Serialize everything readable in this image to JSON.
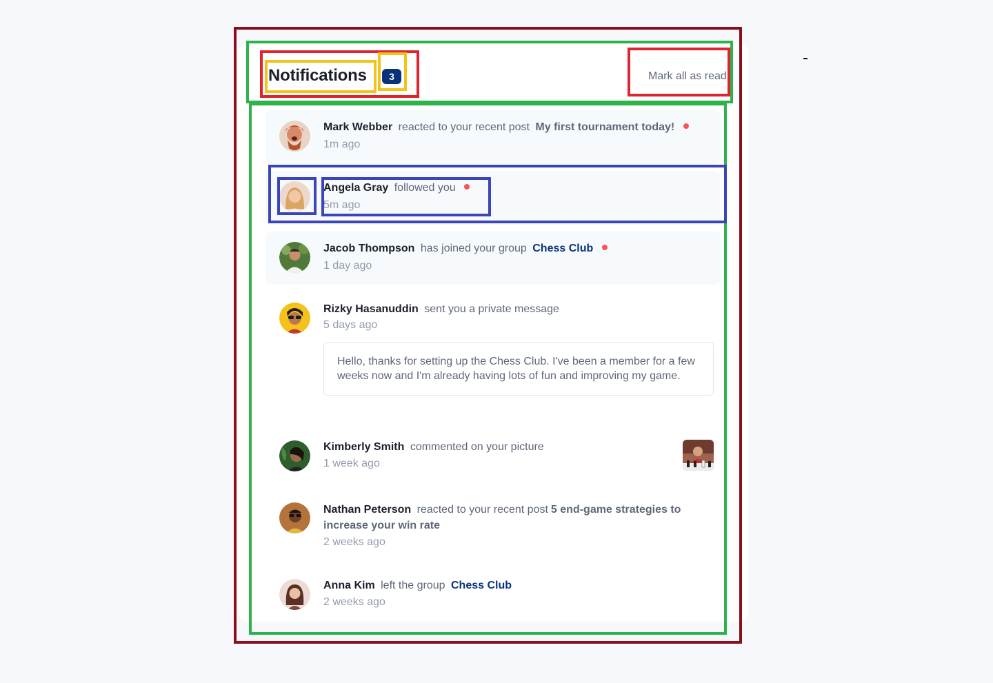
{
  "header": {
    "title": "Notifications",
    "unread_count": "3",
    "mark_all_label": "Mark all as read"
  },
  "colors": {
    "accent": "#0a327b",
    "unread_dot": "#f65552",
    "unread_bg": "#f7fafd"
  },
  "notifications": [
    {
      "name": "Mark Webber",
      "action": "reacted to your recent post",
      "post": "My first tournament today!",
      "time": "1m ago",
      "unread": true,
      "avatar_icon": "avatar-mark-webber"
    },
    {
      "name": "Angela Gray",
      "action": "followed you",
      "time": "5m ago",
      "unread": true,
      "avatar_icon": "avatar-angela-gray"
    },
    {
      "name": "Jacob Thompson",
      "action": "has joined your group",
      "group": "Chess Club",
      "time": "1 day ago",
      "unread": true,
      "avatar_icon": "avatar-jacob-thompson"
    },
    {
      "name": "Rizky Hasanuddin",
      "action": "sent you a private message",
      "time": "5 days ago",
      "unread": false,
      "message": "Hello, thanks for setting up the Chess Club. I've been a member for a few weeks now and I'm already having lots of fun and improving my game.",
      "avatar_icon": "avatar-rizky-hasanuddin"
    },
    {
      "name": "Kimberly Smith",
      "action": "commented on your picture",
      "time": "1 week ago",
      "unread": false,
      "avatar_icon": "avatar-kimberly-smith",
      "picture_icon": "chess-picture-thumbnail"
    },
    {
      "name": "Nathan Peterson",
      "action": "reacted to your recent post",
      "post": "5 end-game strategies to increase your win rate",
      "time": "2 weeks ago",
      "unread": false,
      "avatar_icon": "avatar-nathan-peterson"
    },
    {
      "name": "Anna Kim",
      "action": "left the group",
      "group": "Chess Club",
      "time": "2 weeks ago",
      "unread": false,
      "avatar_icon": "avatar-anna-kim"
    }
  ]
}
